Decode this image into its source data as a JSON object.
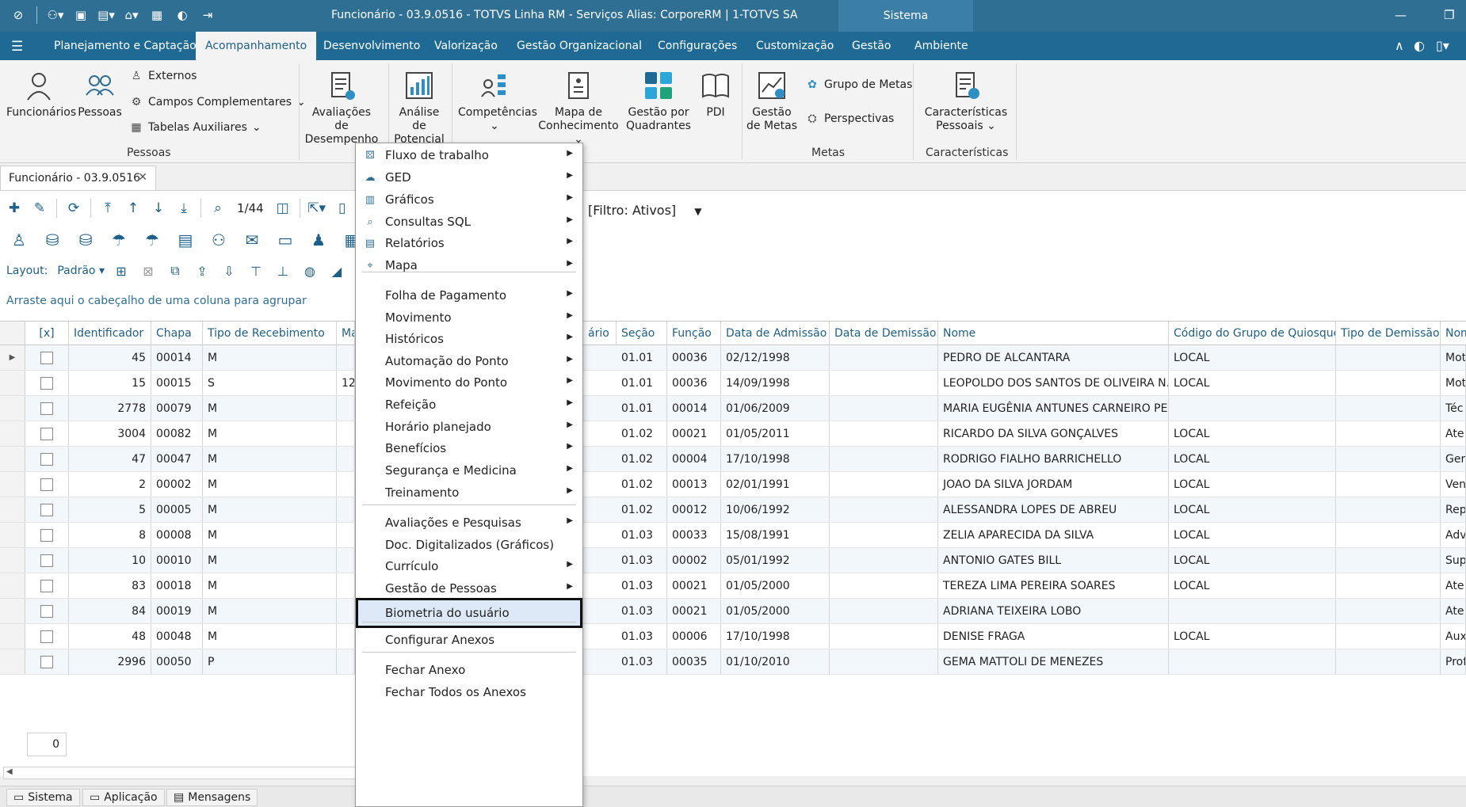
{
  "titlebar": {
    "title": "Funcionário - 03.9.0516 - TOTVS Linha RM - Serviços  Alias: CorporeRM | 1-TOTVS SA",
    "context_tab": "Sistema",
    "minimize": "—",
    "restore": "❐"
  },
  "ribbon_tabs": [
    "Planejamento e Captação",
    "Acompanhamento",
    "Desenvolvimento",
    "Valorização",
    "Gestão Organizacional",
    "Configurações",
    "Customização",
    "Gestão",
    "Ambiente"
  ],
  "ribbon": {
    "pessoas": {
      "label": "Pessoas",
      "funcionarios": "Funcionários",
      "pessoas": "Pessoas",
      "externos": "Externos",
      "campos": "Campos Complementares",
      "tabelas": "Tabelas Auxiliares"
    },
    "avaliacoes": [
      "Avaliações de",
      "Desempenho"
    ],
    "analise": [
      "Análise de",
      "Potencial"
    ],
    "competencias": "Competências",
    "mapa": [
      "Mapa de",
      "Conhecimento"
    ],
    "gestao_quad": [
      "Gestão por",
      "Quadrantes"
    ],
    "pdi": "PDI",
    "metas": {
      "label": "Metas",
      "gestao": [
        "Gestão",
        "de Metas"
      ],
      "grupo": "Grupo de Metas",
      "perspectivas": "Perspectivas"
    },
    "caracteristicas": {
      "label": "Características",
      "btn": [
        "Características",
        "Pessoais"
      ]
    }
  },
  "doc_tab": "Funcionário - 03.9.0516",
  "toolbar": {
    "pager": "1/44",
    "filter": "[Filtro: Ativos]"
  },
  "layoutbar": {
    "label": "Layout:",
    "value": "Padrão"
  },
  "group_hint": "Arraste aqui o cabeçalho de uma coluna para agrupar",
  "grid": {
    "columns": [
      "[x]",
      "Identificador",
      "Chapa",
      "Tipo de Recebimento",
      "Ma",
      "ário",
      "Seção",
      "Função",
      "Data de Admissão",
      "Data de Demissão",
      "Nome",
      "Código do Grupo de Quiosque",
      "Tipo de Demissão",
      "Nom"
    ],
    "rows": [
      {
        "id": "45",
        "chapa": "00014",
        "tipo": "M",
        "ma": "",
        "secao": "01.01",
        "funcao": "00036",
        "adm": "02/12/1998",
        "dem": "",
        "nome": "PEDRO DE ALCANTARA",
        "quiosque": "LOCAL",
        "tdem": "",
        "nom": "Mot"
      },
      {
        "id": "15",
        "chapa": "00015",
        "tipo": "S",
        "ma": "12",
        "secao": "01.01",
        "funcao": "00036",
        "adm": "14/09/1998",
        "dem": "",
        "nome": "LEOPOLDO DOS SANTOS DE OLIVEIRA N...",
        "quiosque": "LOCAL",
        "tdem": "",
        "nom": "Mot"
      },
      {
        "id": "2778",
        "chapa": "00079",
        "tipo": "M",
        "ma": "",
        "secao": "01.01",
        "funcao": "00014",
        "adm": "01/06/2009",
        "dem": "",
        "nome": "MARIA EUGÊNIA ANTUNES CARNEIRO PE...",
        "quiosque": "",
        "tdem": "",
        "nom": "Téc"
      },
      {
        "id": "3004",
        "chapa": "00082",
        "tipo": "M",
        "ma": "",
        "secao": "01.02",
        "funcao": "00021",
        "adm": "01/05/2011",
        "dem": "",
        "nome": "RICARDO DA SILVA GONÇALVES",
        "quiosque": "LOCAL",
        "tdem": "",
        "nom": "Ate"
      },
      {
        "id": "47",
        "chapa": "00047",
        "tipo": "M",
        "ma": "",
        "secao": "01.02",
        "funcao": "00004",
        "adm": "17/10/1998",
        "dem": "",
        "nome": "RODRIGO FIALHO BARRICHELLO",
        "quiosque": "LOCAL",
        "tdem": "",
        "nom": "Ger"
      },
      {
        "id": "2",
        "chapa": "00002",
        "tipo": "M",
        "ma": "",
        "secao": "01.02",
        "funcao": "00013",
        "adm": "02/01/1991",
        "dem": "",
        "nome": "JOAO DA SILVA JORDAM",
        "quiosque": "LOCAL",
        "tdem": "",
        "nom": "Ven"
      },
      {
        "id": "5",
        "chapa": "00005",
        "tipo": "M",
        "ma": "",
        "secao": "01.02",
        "funcao": "00012",
        "adm": "10/06/1992",
        "dem": "",
        "nome": "ALESSANDRA LOPES DE ABREU",
        "quiosque": "LOCAL",
        "tdem": "",
        "nom": "Rep"
      },
      {
        "id": "8",
        "chapa": "00008",
        "tipo": "M",
        "ma": "",
        "secao": "01.03",
        "funcao": "00033",
        "adm": "15/08/1991",
        "dem": "",
        "nome": "ZELIA APARECIDA DA SILVA",
        "quiosque": "LOCAL",
        "tdem": "",
        "nom": "Adv"
      },
      {
        "id": "10",
        "chapa": "00010",
        "tipo": "M",
        "ma": "",
        "secao": "01.03",
        "funcao": "00002",
        "adm": "05/01/1992",
        "dem": "",
        "nome": "ANTONIO GATES BILL",
        "quiosque": "LOCAL",
        "tdem": "",
        "nom": "Sup"
      },
      {
        "id": "83",
        "chapa": "00018",
        "tipo": "M",
        "ma": "",
        "secao": "01.03",
        "funcao": "00021",
        "adm": "01/05/2000",
        "dem": "",
        "nome": "TEREZA LIMA PEREIRA SOARES",
        "quiosque": "LOCAL",
        "tdem": "",
        "nom": "Ate"
      },
      {
        "id": "84",
        "chapa": "00019",
        "tipo": "M",
        "ma": "",
        "secao": "01.03",
        "funcao": "00021",
        "adm": "01/05/2000",
        "dem": "",
        "nome": "ADRIANA TEIXEIRA LOBO",
        "quiosque": "",
        "tdem": "",
        "nom": "Ate"
      },
      {
        "id": "48",
        "chapa": "00048",
        "tipo": "M",
        "ma": "",
        "secao": "01.03",
        "funcao": "00006",
        "adm": "17/10/1998",
        "dem": "",
        "nome": "DENISE FRAGA",
        "quiosque": "LOCAL",
        "tdem": "",
        "nom": "Aux"
      },
      {
        "id": "2996",
        "chapa": "00050",
        "tipo": "P",
        "ma": "",
        "secao": "01.03",
        "funcao": "00035",
        "adm": "01/10/2010",
        "dem": "",
        "nome": "GEMA MATTOLI DE MENEZES",
        "quiosque": "",
        "tdem": "",
        "nom": "Prof"
      }
    ],
    "footer_count": "0"
  },
  "menu": {
    "items": [
      {
        "label": "Fluxo de trabalho",
        "icon": "workflow-icon",
        "sub": true
      },
      {
        "label": "GED",
        "icon": "ged-icon",
        "sub": true
      },
      {
        "label": "Gráficos",
        "icon": "chart-icon",
        "sub": true
      },
      {
        "label": "Consultas SQL",
        "icon": "search-icon",
        "sub": true
      },
      {
        "label": "Relatórios",
        "icon": "report-icon",
        "sub": true
      },
      {
        "label": "Mapa",
        "icon": "map-pin-icon",
        "sub": true
      },
      {
        "label": "Folha de Pagamento",
        "sub": true
      },
      {
        "label": "Movimento",
        "sub": true
      },
      {
        "label": "Históricos",
        "sub": true
      },
      {
        "label": "Automação do Ponto",
        "sub": true
      },
      {
        "label": "Movimento do Ponto",
        "sub": true
      },
      {
        "label": "Refeição",
        "sub": true
      },
      {
        "label": "Horário planejado",
        "sub": true
      },
      {
        "label": "Benefícios",
        "sub": true
      },
      {
        "label": "Segurança e Medicina",
        "sub": true
      },
      {
        "label": "Treinamento",
        "sub": true
      },
      {
        "label": "Avaliações e Pesquisas",
        "sub": true
      },
      {
        "label": "Doc. Digitalizados (Gráficos)",
        "sub": false
      },
      {
        "label": "Currículo",
        "sub": true
      },
      {
        "label": "Gestão de Pessoas",
        "sub": true
      },
      {
        "label": "Biometria do usuário",
        "sub": false,
        "highlight": true
      },
      {
        "label": "Configurar Anexos",
        "sub": false
      },
      {
        "label": "Fechar Anexo",
        "sub": false
      },
      {
        "label": "Fechar Todos os Anexos",
        "sub": false
      }
    ]
  },
  "statusbar": [
    "Sistema",
    "Aplicação",
    "Mensagens"
  ],
  "colors": {
    "titlebar": "#2f6f93",
    "ribbon_tabs": "#1f6a95",
    "accent": "#1f5f86",
    "row_alt": "#f2f7fb"
  }
}
